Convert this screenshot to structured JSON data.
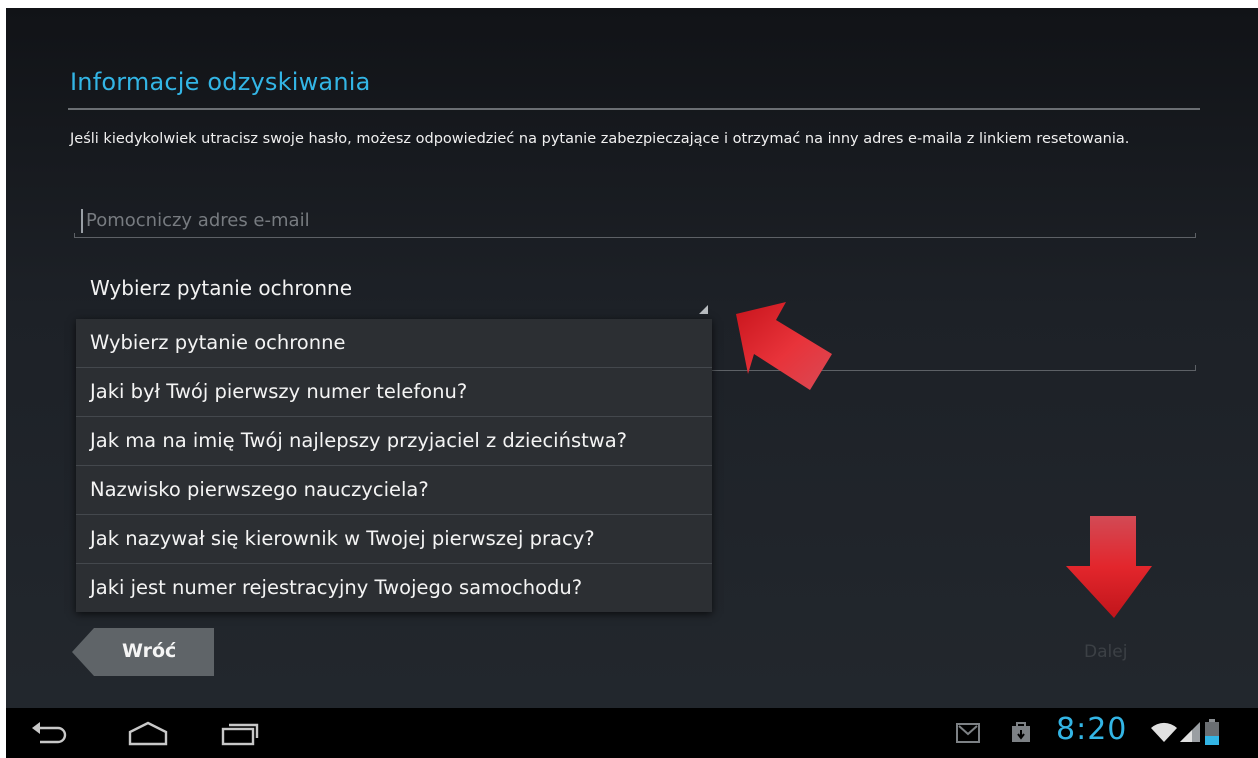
{
  "recovery": {
    "title": "Informacje odzyskiwania",
    "description": "Jeśli kiedykolwiek utracisz swoje hasło, możesz odpowiedzieć na pytanie zabezpieczające i otrzymać na inny adres e-maila z linkiem resetowania.",
    "secondary_email_placeholder": "Pomocniczy adres e-mail",
    "security_question_selected": "Wybierz pytanie ochronne"
  },
  "dropdown": {
    "options": [
      "Wybierz pytanie ochronne",
      "Jaki był Twój pierwszy numer telefonu?",
      "Jak ma na imię Twój najlepszy przyjaciel z dzieciństwa?",
      "Nazwisko pierwszego nauczyciela?",
      "Jak nazywał się kierownik w Twojej pierwszej pracy?",
      "Jaki jest numer rejestracyjny Twojego samochodu?"
    ]
  },
  "buttons": {
    "back": "Wróć",
    "next": "Dalej"
  },
  "statusbar": {
    "time": "8:20",
    "icons": [
      "gmail-icon",
      "download-icon",
      "wifi-icon",
      "signal-icon",
      "battery-icon"
    ]
  },
  "navbar": {
    "icons": [
      "back-icon",
      "home-icon",
      "recent-apps-icon"
    ]
  },
  "colors": {
    "accent": "#33b5e5",
    "annotation_arrow": "#d9252b"
  }
}
